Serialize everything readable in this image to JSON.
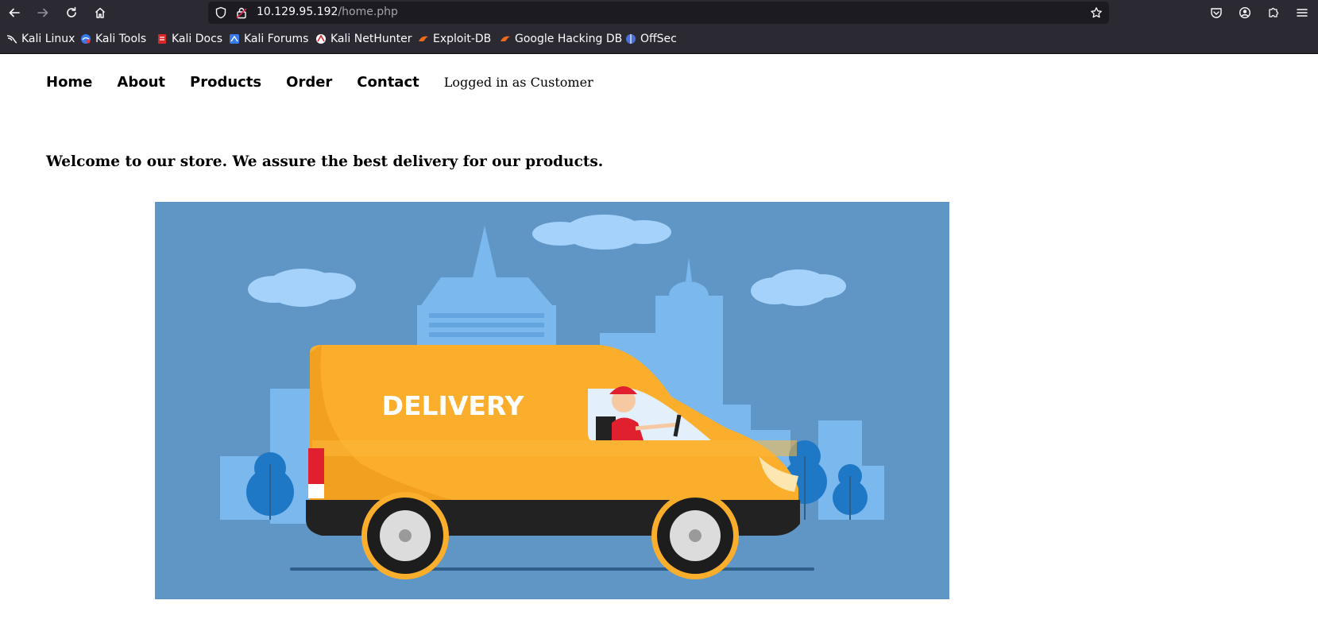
{
  "browser": {
    "url_host": "10.129.95.192",
    "url_path": "/home.php",
    "bookmarks": [
      {
        "label": "Kali Linux",
        "icon": "kali-dragon-icon"
      },
      {
        "label": "Kali Tools",
        "icon": "kali-tools-icon"
      },
      {
        "label": "Kali Docs",
        "icon": "kali-docs-icon"
      },
      {
        "label": "Kali Forums",
        "icon": "kali-forums-icon"
      },
      {
        "label": "Kali NetHunter",
        "icon": "nethunter-icon"
      },
      {
        "label": "Exploit-DB",
        "icon": "exploit-db-icon"
      },
      {
        "label": "Google Hacking DB",
        "icon": "ghdb-icon"
      },
      {
        "label": "OffSec",
        "icon": "offsec-icon"
      }
    ]
  },
  "nav": {
    "items": [
      "Home",
      "About",
      "Products",
      "Order",
      "Contact"
    ],
    "status": "Logged in as Customer"
  },
  "main": {
    "welcome": "Welcome to our store. We assure the best delivery for our products.",
    "hero_label": "DELIVERY"
  },
  "colors": {
    "sky": "#6096c6",
    "van": "#fbae2c",
    "building": "#7ab8ee",
    "tree": "#1f78c6",
    "chrome": "#2b2a33"
  }
}
